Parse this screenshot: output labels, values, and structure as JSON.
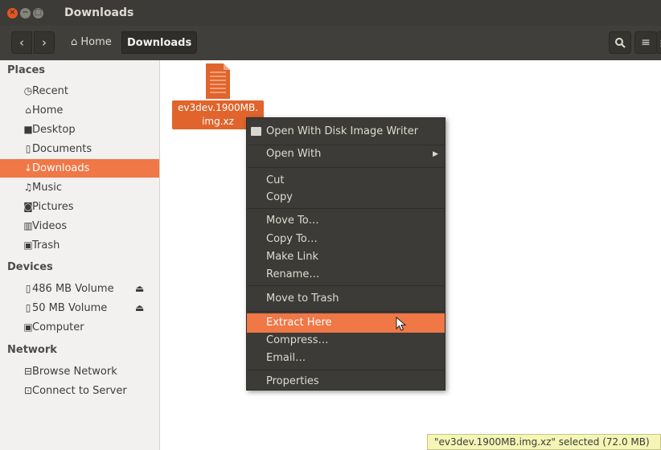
{
  "window": {
    "title": "Downloads"
  },
  "toolbar": {
    "back_glyph": "‹",
    "forward_glyph": "›",
    "breadcrumbs": [
      "Home",
      "Downloads"
    ],
    "icons": [
      "home-icon",
      "search-icon",
      "list-view-icon",
      "grid-view-icon"
    ]
  },
  "sidebar": {
    "places_heading": "Places",
    "places": [
      {
        "label": "Recent",
        "icon": "clock-icon"
      },
      {
        "label": "Home",
        "icon": "home-icon"
      },
      {
        "label": "Desktop",
        "icon": "folder-icon"
      },
      {
        "label": "Documents",
        "icon": "document-icon"
      },
      {
        "label": "Downloads",
        "icon": "download-icon",
        "selected": true
      },
      {
        "label": "Music",
        "icon": "music-icon"
      },
      {
        "label": "Pictures",
        "icon": "camera-icon"
      },
      {
        "label": "Videos",
        "icon": "film-icon"
      },
      {
        "label": "Trash",
        "icon": "trash-icon"
      }
    ],
    "devices_heading": "Devices",
    "devices": [
      {
        "label": "486 MB Volume",
        "icon": "usb-drive-icon",
        "eject": true
      },
      {
        "label": "50 MB Volume",
        "icon": "usb-drive-icon",
        "eject": true
      },
      {
        "label": "Computer",
        "icon": "computer-icon"
      }
    ],
    "network_heading": "Network",
    "network": [
      {
        "label": "Browse Network",
        "icon": "network-icon"
      },
      {
        "label": "Connect to Server",
        "icon": "server-icon"
      }
    ]
  },
  "file": {
    "name_line1": "ev3dev.1900MB.",
    "name_line2": "img.xz",
    "icon": "archive-file-icon"
  },
  "context_menu": {
    "items": [
      {
        "label": "Open With Disk Image Writer",
        "mnemonic": "O",
        "icon": "disk-image-writer-icon"
      },
      {
        "label": "Open With",
        "mnemonic": "h",
        "submenu": true
      },
      {
        "label": "Cut",
        "mnemonic": "t"
      },
      {
        "label": "Copy",
        "mnemonic": "C"
      },
      {
        "label": "Move To…"
      },
      {
        "label": "Copy To…"
      },
      {
        "label": "Make Link",
        "mnemonic": "k"
      },
      {
        "label": "Rename…",
        "mnemonic": "m"
      },
      {
        "label": "Move to Trash",
        "mnemonic": "v"
      },
      {
        "label": "Extract Here",
        "highlighted": true
      },
      {
        "label": "Compress…"
      },
      {
        "label": "Email…"
      },
      {
        "label": "Properties",
        "mnemonic": "r"
      }
    ]
  },
  "status_bar": {
    "text": "\"ev3dev.1900MB.img.xz\" selected (72.0 MB)"
  },
  "colors": {
    "accent": "#f07746",
    "titlebar": "#3c3b37",
    "menu_bg": "#3c3b37",
    "sidebar_bg": "#f2f1f0"
  }
}
